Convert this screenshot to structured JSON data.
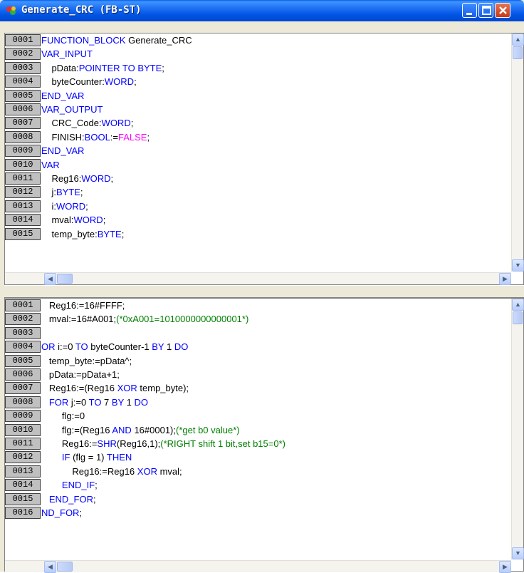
{
  "window": {
    "title": "Generate_CRC (FB-ST)"
  },
  "declaration_pane": {
    "lines": [
      {
        "num": "0001",
        "parts": [
          {
            "t": "FUNCTION_BLOCK",
            "c": "kw"
          },
          {
            "t": " Generate_CRC",
            "c": ""
          }
        ]
      },
      {
        "num": "0002",
        "parts": [
          {
            "t": "VAR_INPUT",
            "c": "kw"
          }
        ]
      },
      {
        "num": "0003",
        "parts": [
          {
            "t": "    pData:",
            "c": ""
          },
          {
            "t": "POINTER TO BYTE",
            "c": "kw"
          },
          {
            "t": ";",
            "c": ""
          }
        ]
      },
      {
        "num": "0004",
        "parts": [
          {
            "t": "    byteCounter:",
            "c": ""
          },
          {
            "t": "WORD",
            "c": "kw"
          },
          {
            "t": ";",
            "c": ""
          }
        ]
      },
      {
        "num": "0005",
        "parts": [
          {
            "t": "END_VAR",
            "c": "kw"
          }
        ]
      },
      {
        "num": "0006",
        "parts": [
          {
            "t": "VAR_OUTPUT",
            "c": "kw"
          }
        ]
      },
      {
        "num": "0007",
        "parts": [
          {
            "t": "    CRC_Code:",
            "c": ""
          },
          {
            "t": "WORD",
            "c": "kw"
          },
          {
            "t": ";",
            "c": ""
          }
        ]
      },
      {
        "num": "0008",
        "parts": [
          {
            "t": "    FINISH:",
            "c": ""
          },
          {
            "t": "BOOL",
            "c": "kw"
          },
          {
            "t": ":=",
            "c": ""
          },
          {
            "t": "FALSE",
            "c": "str"
          },
          {
            "t": ";",
            "c": ""
          }
        ]
      },
      {
        "num": "0009",
        "parts": [
          {
            "t": "END_VAR",
            "c": "kw"
          }
        ]
      },
      {
        "num": "0010",
        "parts": [
          {
            "t": "VAR",
            "c": "kw"
          }
        ]
      },
      {
        "num": "0011",
        "parts": [
          {
            "t": "    Reg16:",
            "c": ""
          },
          {
            "t": "WORD",
            "c": "kw"
          },
          {
            "t": ";",
            "c": ""
          }
        ]
      },
      {
        "num": "0012",
        "parts": [
          {
            "t": "    j:",
            "c": ""
          },
          {
            "t": "BYTE",
            "c": "kw"
          },
          {
            "t": ";",
            "c": ""
          }
        ]
      },
      {
        "num": "0013",
        "parts": [
          {
            "t": "    i:",
            "c": ""
          },
          {
            "t": "WORD",
            "c": "kw"
          },
          {
            "t": ";",
            "c": ""
          }
        ]
      },
      {
        "num": "0014",
        "parts": [
          {
            "t": "    mval:",
            "c": ""
          },
          {
            "t": "WORD",
            "c": "kw"
          },
          {
            "t": ";",
            "c": ""
          }
        ]
      },
      {
        "num": "0015",
        "parts": [
          {
            "t": "    temp_byte:",
            "c": ""
          },
          {
            "t": "BYTE",
            "c": "kw"
          },
          {
            "t": ";",
            "c": ""
          }
        ]
      }
    ]
  },
  "body_pane": {
    "lines": [
      {
        "num": "0001",
        "parts": [
          {
            "t": "   Reg16:=16#FFFF;",
            "c": ""
          }
        ]
      },
      {
        "num": "0002",
        "parts": [
          {
            "t": "   mval:=16#A001;",
            "c": ""
          },
          {
            "t": "(*0xA001=1010000000000001*)",
            "c": "cm"
          }
        ]
      },
      {
        "num": "0003",
        "parts": []
      },
      {
        "num": "0004",
        "parts": [
          {
            "t": "OR",
            "c": "kw"
          },
          {
            "t": " i:=0 ",
            "c": ""
          },
          {
            "t": "TO",
            "c": "kw"
          },
          {
            "t": " byteCounter-1 ",
            "c": ""
          },
          {
            "t": "BY",
            "c": "kw"
          },
          {
            "t": " 1 ",
            "c": ""
          },
          {
            "t": "DO",
            "c": "kw"
          }
        ]
      },
      {
        "num": "0005",
        "parts": [
          {
            "t": "   temp_byte:=pData^;",
            "c": ""
          }
        ]
      },
      {
        "num": "0006",
        "parts": [
          {
            "t": "   pData:=pData+1;",
            "c": ""
          }
        ]
      },
      {
        "num": "0007",
        "parts": [
          {
            "t": "   Reg16:=(Reg16 ",
            "c": ""
          },
          {
            "t": "XOR",
            "c": "kw"
          },
          {
            "t": " temp_byte);",
            "c": ""
          }
        ]
      },
      {
        "num": "0008",
        "parts": [
          {
            "t": "   ",
            "c": ""
          },
          {
            "t": "FOR",
            "c": "kw"
          },
          {
            "t": " j:=0 ",
            "c": ""
          },
          {
            "t": "TO",
            "c": "kw"
          },
          {
            "t": " 7 ",
            "c": ""
          },
          {
            "t": "BY",
            "c": "kw"
          },
          {
            "t": " 1 ",
            "c": ""
          },
          {
            "t": "DO",
            "c": "kw"
          }
        ]
      },
      {
        "num": "0009",
        "parts": [
          {
            "t": "        flg:=0",
            "c": ""
          }
        ]
      },
      {
        "num": "0010",
        "parts": [
          {
            "t": "        flg:=(Reg16 ",
            "c": ""
          },
          {
            "t": "AND",
            "c": "kw"
          },
          {
            "t": " 16#0001);",
            "c": ""
          },
          {
            "t": "(*get b0 value*)",
            "c": "cm"
          }
        ]
      },
      {
        "num": "0011",
        "parts": [
          {
            "t": "        Reg16:=",
            "c": ""
          },
          {
            "t": "SHR",
            "c": "kw"
          },
          {
            "t": "(Reg16,1);",
            "c": ""
          },
          {
            "t": "(*RIGHT shift 1 bit,set b15=0*)",
            "c": "cm"
          }
        ]
      },
      {
        "num": "0012",
        "parts": [
          {
            "t": "        ",
            "c": ""
          },
          {
            "t": "IF",
            "c": "kw"
          },
          {
            "t": " (flg = 1) ",
            "c": ""
          },
          {
            "t": "THEN",
            "c": "kw"
          }
        ]
      },
      {
        "num": "0013",
        "parts": [
          {
            "t": "            Reg16:=Reg16 ",
            "c": ""
          },
          {
            "t": "XOR",
            "c": "kw"
          },
          {
            "t": " mval;",
            "c": ""
          }
        ]
      },
      {
        "num": "0014",
        "parts": [
          {
            "t": "        ",
            "c": ""
          },
          {
            "t": "END_IF",
            "c": "kw"
          },
          {
            "t": ";",
            "c": ""
          }
        ]
      },
      {
        "num": "0015",
        "parts": [
          {
            "t": "   ",
            "c": ""
          },
          {
            "t": "END_FOR",
            "c": "kw"
          },
          {
            "t": ";",
            "c": ""
          }
        ]
      },
      {
        "num": "0016",
        "parts": [
          {
            "t": "ND_FOR",
            "c": "kw"
          },
          {
            "t": ";",
            "c": ""
          }
        ]
      }
    ]
  },
  "colors": {
    "keyword": "#0000ff",
    "literal": "#ff00ff",
    "comment": "#008000",
    "gutter": "#c0c0c0",
    "titlebar": "#0054e3"
  },
  "icons": {
    "app": "pou-icon",
    "minimize": "minimize-icon",
    "maximize": "maximize-icon",
    "close": "close-icon"
  }
}
